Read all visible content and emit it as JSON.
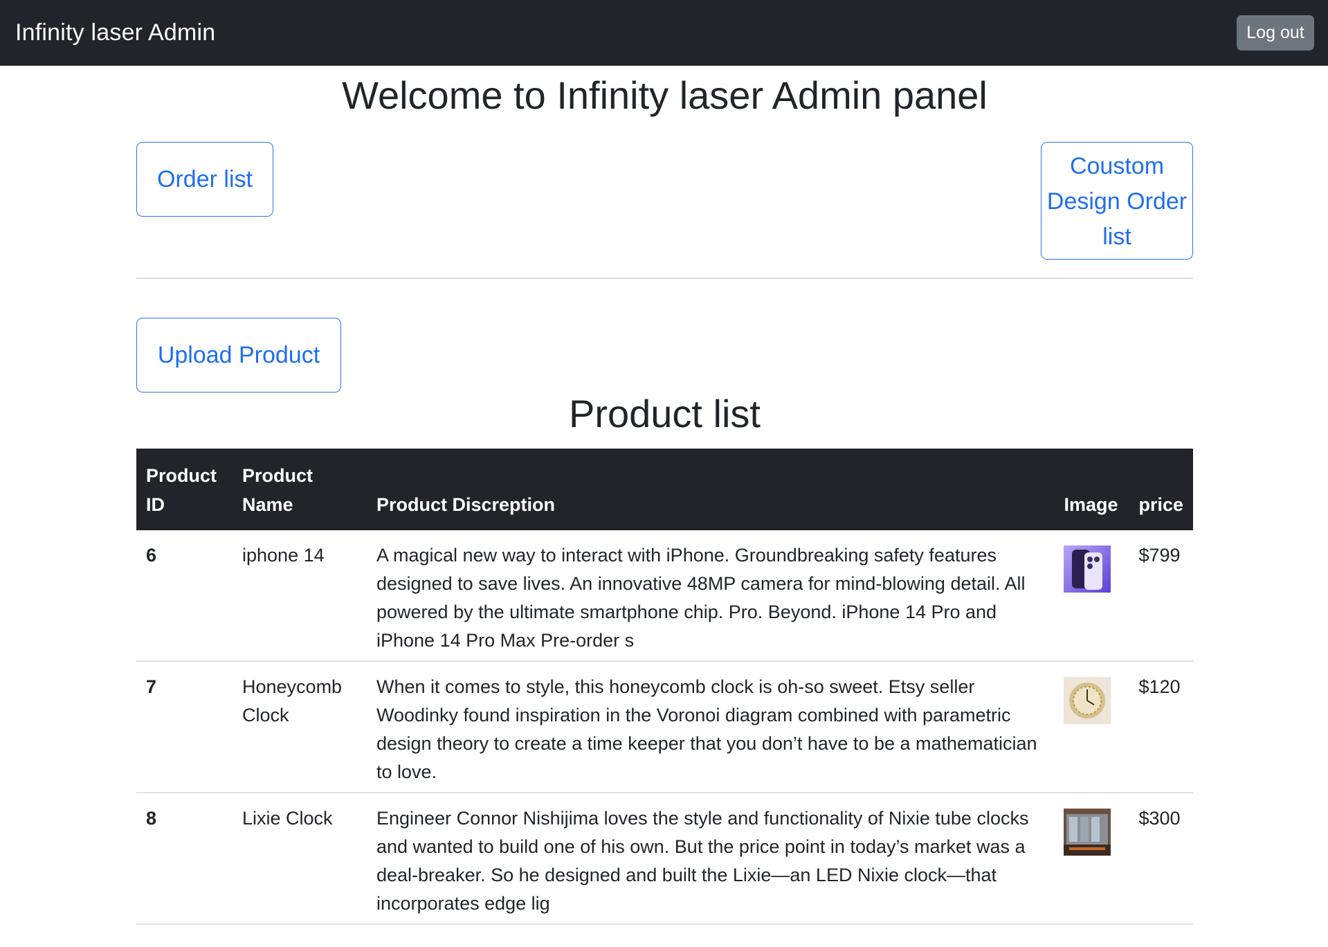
{
  "navbar": {
    "brand": "Infinity laser Admin",
    "logout_label": "Log out"
  },
  "main": {
    "welcome_title": "Welcome to Infinity laser Admin panel",
    "order_list_label": "Order list",
    "custom_order_label": "Coustom Design Order list",
    "upload_label": "Upload Product",
    "product_list_title": "Product list"
  },
  "table": {
    "headers": {
      "id": "Product ID",
      "name": "Product Name",
      "description": "Product Discreption",
      "image": "Image",
      "price": "price"
    },
    "rows": [
      {
        "id": "6",
        "name": "iphone 14",
        "description": "A magical new way to interact with iPhone. Groundbreaking safety features designed to save lives. An innovative 48MP camera for mind-blowing detail. All powered by the ultimate smartphone chip. Pro. Beyond. iPhone 14 Pro and iPhone 14 Pro Max Pre-order s",
        "image_icon": "phone-thumbnail",
        "price": "$799"
      },
      {
        "id": "7",
        "name": "Honeycomb Clock",
        "description": "When it comes to style, this honeycomb clock is oh-so sweet. Etsy seller Woodinky found inspiration in the Voronoi diagram combined with parametric design theory to create a time keeper that you don’t have to be a mathematician to love.",
        "image_icon": "clock-thumbnail",
        "price": "$120"
      },
      {
        "id": "8",
        "name": "Lixie Clock",
        "description": "Engineer Connor Nishijima loves the style and functionality of Nixie tube clocks and wanted to build one of his own. But the price point in today’s market was a deal-breaker. So he designed and built the Lixie—an LED Nixie clock—that incorporates edge lig",
        "image_icon": "lixie-thumbnail",
        "price": "$300"
      }
    ]
  },
  "colors": {
    "navbar_bg": "#212529",
    "primary": "#0d6efd",
    "secondary": "#6c757d"
  }
}
